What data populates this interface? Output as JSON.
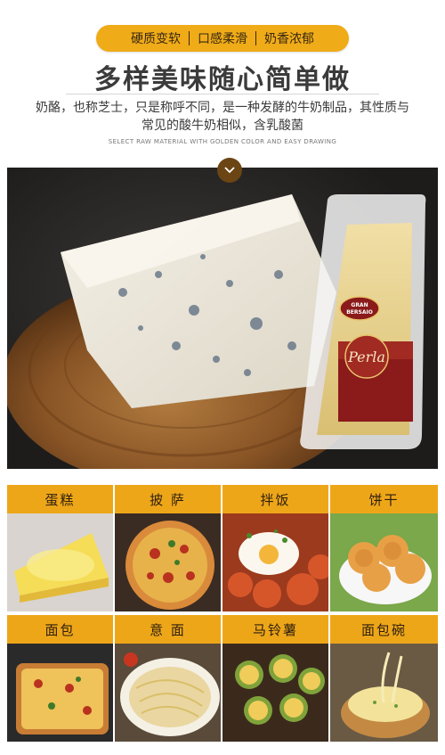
{
  "features": [
    "硬质变软",
    "口感柔滑",
    "奶香浓郁"
  ],
  "headline": "多样美味随心简单做",
  "description": "奶酪，也称芝士，只是称呼不同，是一种发酵的牛奶制品，其性质与常见的酸牛奶相似，含乳酸菌",
  "subtitle": "SELECT RAW MATERIAL WITH GOLDEN COLOR AND EASY DRAWING",
  "package": {
    "brand_top": "GRAN",
    "brand_bottom": "BERSAIO",
    "brand_script": "Perla"
  },
  "categories_row1": [
    "蛋糕",
    "披 萨",
    "拌饭",
    "饼干"
  ],
  "categories_row2": [
    "面包",
    "意 面",
    "马铃薯",
    "面包碗"
  ],
  "colors": {
    "accent": "#f0ab18",
    "brown": "#6b4514",
    "label_red": "#8b1a1a"
  }
}
